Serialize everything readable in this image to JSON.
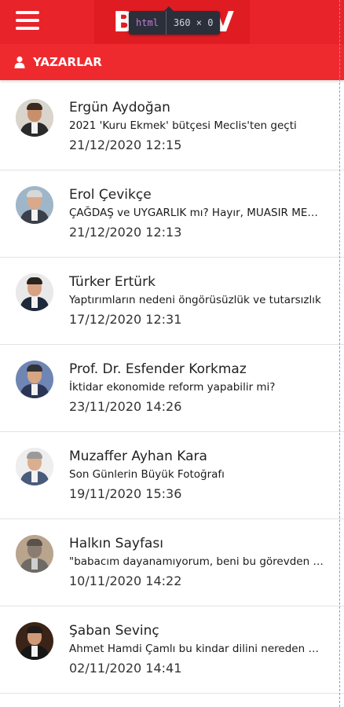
{
  "header": {
    "logo_left": "B",
    "logo_right": "V"
  },
  "devtools_tooltip": {
    "tag": "html",
    "size": "360 × 0"
  },
  "section": {
    "title": "YAZARLAR",
    "icon": "user-icon"
  },
  "colors": {
    "brand_red": "#e8232a",
    "section_red": "#ef2a2f",
    "text_dark": "#222222"
  },
  "authors": [
    {
      "name": "Ergün Aydoğan",
      "title": "2021 'Kuru Ekmek' bütçesi Meclis'ten geçti",
      "date": "21/12/2020 12:15"
    },
    {
      "name": "Erol Çevikçe",
      "title": "ÇAĞDAŞ ve UYGARLIK mı? Hayır, MUASIR MEDENİYET",
      "date": "21/12/2020 12:13"
    },
    {
      "name": "Türker Ertürk",
      "title": "Yaptırımların nedeni öngörüsüzlük ve tutarsızlık",
      "date": "17/12/2020 12:31"
    },
    {
      "name": "Prof. Dr. Esfender Korkmaz",
      "title": "İktidar ekonomide reform yapabilir mi?",
      "date": "23/11/2020 14:26"
    },
    {
      "name": "Muzaffer Ayhan Kara",
      "title": "Son Günlerin Büyük Fotoğrafı",
      "date": "19/11/2020 15:36"
    },
    {
      "name": "Halkın Sayfası",
      "title": " \"babacım dayanamıyorum, beni bu görevden alın\"",
      "date": "10/11/2020 14:22"
    },
    {
      "name": "Şaban Sevinç",
      "title": "Ahmet Hamdi Çamlı bu kindar dilini nereden buldu",
      "date": "02/11/2020 14:41"
    }
  ]
}
